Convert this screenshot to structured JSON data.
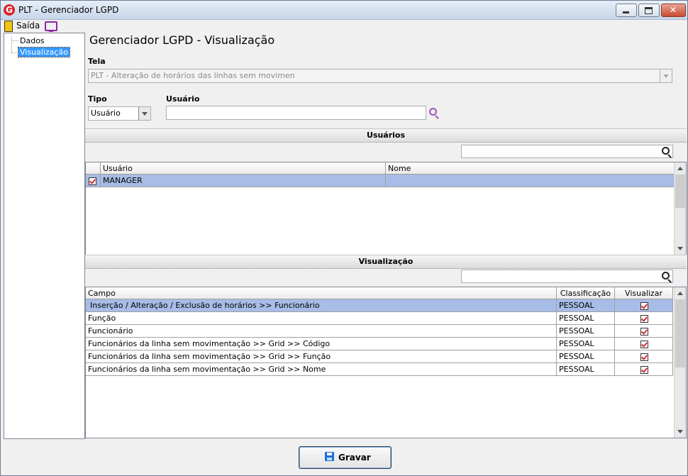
{
  "window": {
    "title": "PLT - Gerenciador LGPD",
    "icon": "app-logo-icon"
  },
  "menu": {
    "exit_label": "Saída"
  },
  "tree": {
    "items": [
      {
        "label": "Dados",
        "selected": false
      },
      {
        "label": "Visualização",
        "selected": true
      }
    ]
  },
  "page": {
    "heading": "Gerenciador LGPD - Visualização"
  },
  "form": {
    "tela_label": "Tela",
    "tela_value": "PLT - Alteração de horários das linhas sem movimen",
    "tipo_label": "Tipo",
    "tipo_value": "Usuário",
    "usuario_label": "Usuário",
    "usuario_value": ""
  },
  "users_section": {
    "title": "Usuários",
    "search_value": "",
    "columns": [
      "Usuário",
      "Nome"
    ],
    "rows": [
      {
        "checked": true,
        "usuario": "MANAGER",
        "nome": ""
      }
    ]
  },
  "view_section": {
    "title": "Visualização",
    "search_value": "",
    "columns": [
      "Campo",
      "Classificação",
      "Visualizar"
    ],
    "rows": [
      {
        "campo": "Inserção / Alteração / Exclusão de horários >> Funcionário",
        "classificacao": "PESSOAL",
        "visualizar": true
      },
      {
        "campo": "Função",
        "classificacao": "PESSOAL",
        "visualizar": true
      },
      {
        "campo": "Funcionário",
        "classificacao": "PESSOAL",
        "visualizar": true
      },
      {
        "campo": "Funcionários da linha sem movimentação >> Grid >> Código",
        "classificacao": "PESSOAL",
        "visualizar": true
      },
      {
        "campo": "Funcionários da linha sem movimentação >> Grid >> Função",
        "classificacao": "PESSOAL",
        "visualizar": true
      },
      {
        "campo": "Funcionários da linha sem movimentação >> Grid >> Nome",
        "classificacao": "PESSOAL",
        "visualizar": true
      }
    ]
  },
  "actions": {
    "save_label": "Gravar"
  },
  "colors": {
    "selected_row": "#a7bce6",
    "tree_selected": "#3399ff",
    "check_mark": "#d32f2f"
  }
}
